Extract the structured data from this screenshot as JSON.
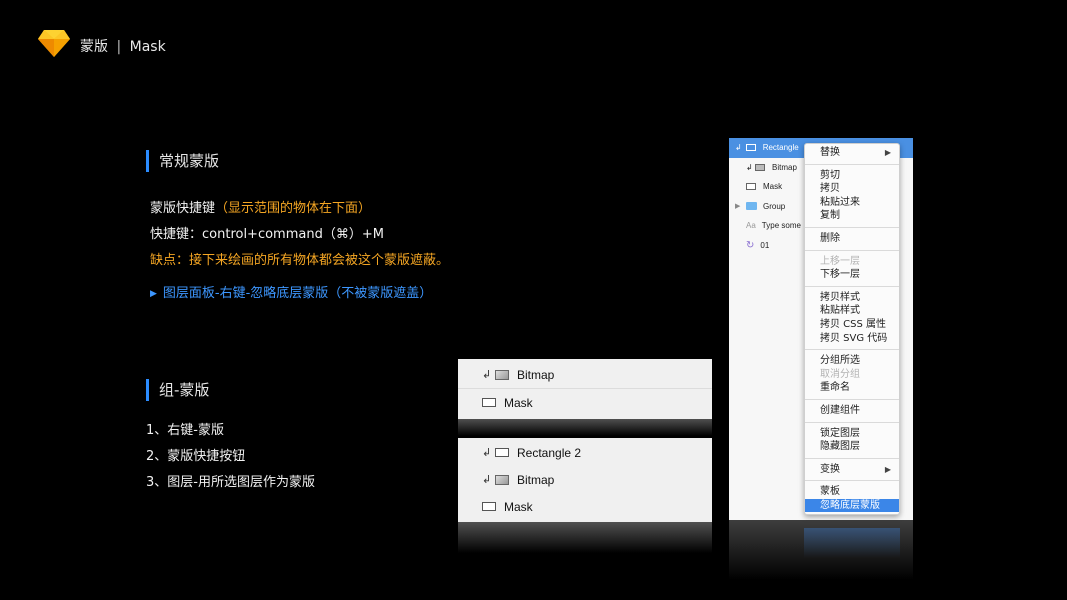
{
  "header": {
    "icon": "sketch-diamond-icon",
    "title": "蒙版",
    "separator": "|",
    "subtitle": "Mask"
  },
  "section1": {
    "title": "常规蒙版",
    "line1_prefix": "蒙版快捷键",
    "line1_note": "（显示范围的物体在下面）",
    "line2": "快捷键：control+command（⌘）+M",
    "line3": "缺点：接下来绘画的所有物体都会被这个蒙版遮蔽。",
    "tip": "图层面板-右键-忽略底层蒙版（不被蒙版遮盖）"
  },
  "section2": {
    "title": "组-蒙版",
    "items": [
      "1、右键-蒙版",
      "2、蒙版快捷按钮",
      "3、图层-用所选图层作为蒙版"
    ]
  },
  "panelA": {
    "rows": [
      {
        "arrow": "↲",
        "icon": "image-icon",
        "label": "Bitmap"
      },
      {
        "icon": "rectangle-icon",
        "label": "Mask"
      }
    ]
  },
  "panelB": {
    "rows": [
      {
        "arrow": "↲",
        "icon": "rectangle-icon",
        "label": "Rectangle 2"
      },
      {
        "arrow": "↲",
        "icon": "image-icon",
        "label": "Bitmap"
      },
      {
        "icon": "rectangle-icon",
        "label": "Mask"
      }
    ]
  },
  "app_layers": [
    {
      "label": "Rectangle",
      "selected": true
    },
    {
      "label": "Bitmap"
    },
    {
      "label": "Mask"
    },
    {
      "label": "Group"
    },
    {
      "prefix": "Aa",
      "label": "Type some"
    },
    {
      "label": "01"
    }
  ],
  "context_menu": {
    "items": [
      "替换",
      "剪切",
      "拷贝",
      "粘贴过来",
      "复制",
      "删除",
      "上移一层",
      "下移一层",
      "拷贝样式",
      "粘贴样式",
      "拷贝 CSS 属性",
      "拷贝 SVG 代码",
      "分组所选",
      "取消分组",
      "重命名",
      "创建组件",
      "锁定图层",
      "隐藏图层",
      "变换",
      "蒙板",
      "忽略底层蒙版"
    ],
    "submenu_glyph": "▶"
  },
  "colors": {
    "accent_blue": "#2b8cff",
    "orange": "#f5a623",
    "selection": "#3b86e8"
  }
}
